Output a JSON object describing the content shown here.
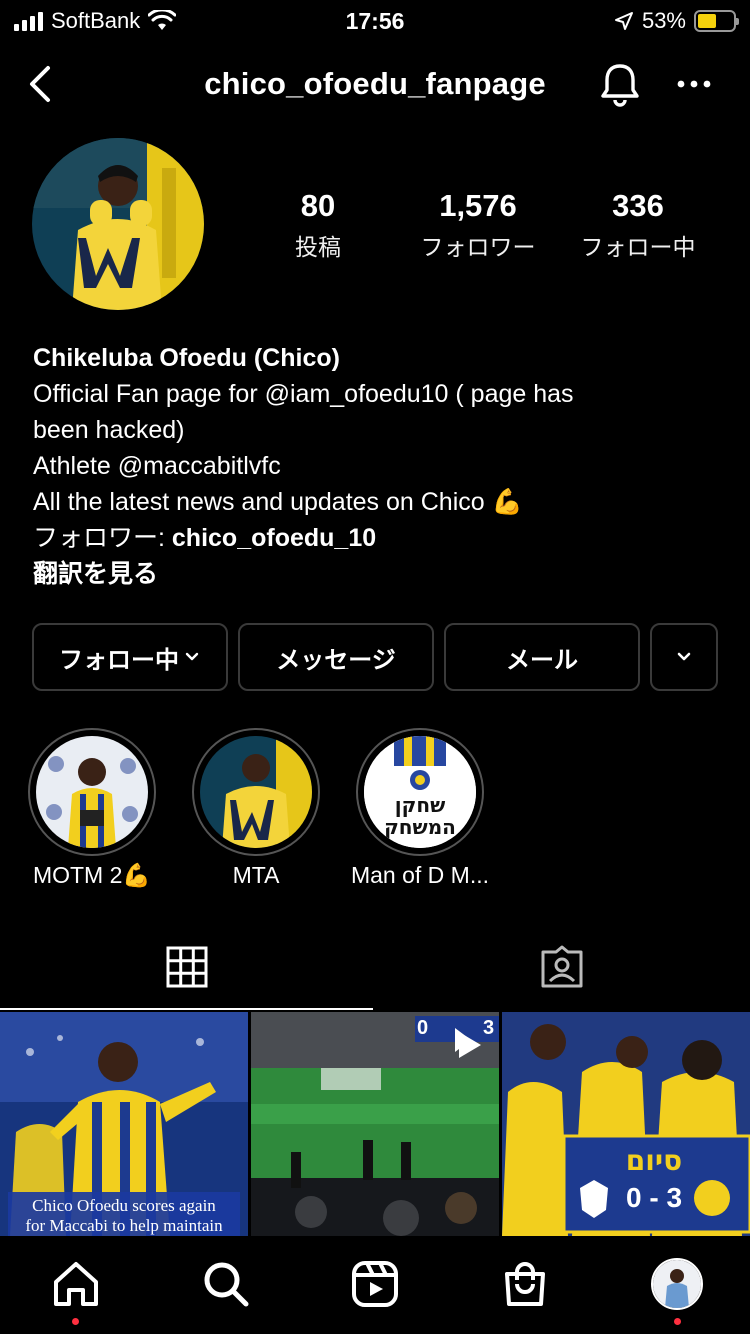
{
  "status_bar": {
    "carrier": "SoftBank",
    "time": "17:56",
    "battery_percent": "53%",
    "battery_level": 0.53,
    "icons": [
      "signal-icon",
      "wifi-icon",
      "location-arrow-icon",
      "battery-icon"
    ]
  },
  "header": {
    "username": "chico_ofoedu_fanpage",
    "icons": [
      "back-chevron-icon",
      "bell-icon",
      "more-dots-icon"
    ]
  },
  "stats": [
    {
      "value": "80",
      "label": "投稿"
    },
    {
      "value": "1,576",
      "label": "フォロワー"
    },
    {
      "value": "336",
      "label": "フォロー中"
    }
  ],
  "bio": {
    "name": "Chikeluba Ofoedu (Chico)",
    "line1": "Official Fan page for @iam_ofoedu10 ( page has",
    "line2": "been hacked)",
    "line3": "Athlete @maccabitlvfc",
    "line4": "All the latest news and updates on Chico 💪",
    "followers_prefix": "フォロワー: ",
    "followers_name": "chico_ofoedu_10",
    "translate": "翻訳を見る"
  },
  "buttons": {
    "following": "フォロー中",
    "message": "メッセージ",
    "email": "メール"
  },
  "highlights": [
    {
      "label": "MOTM 2💪"
    },
    {
      "label": "MTA"
    },
    {
      "label": "Man of D M..."
    }
  ],
  "highlight_art": {
    "hebrew_line1": "שחקן",
    "hebrew_line2": "המשחק"
  },
  "posts": [
    {
      "caption_line1": "Chico Ofoedu scores again",
      "caption_line2": "for Maccabi to help maintain"
    },
    {
      "scoreboard": "0",
      "scoreboard2": "3",
      "is_video": true
    },
    {
      "hebrew_word": "סיום",
      "score": "0 - 3"
    }
  ],
  "colors": {
    "background": "#000000",
    "accent_yellow": "#f5d20c",
    "maccabi_blue": "#1d3a8f",
    "notification_dot": "#ff3040"
  }
}
